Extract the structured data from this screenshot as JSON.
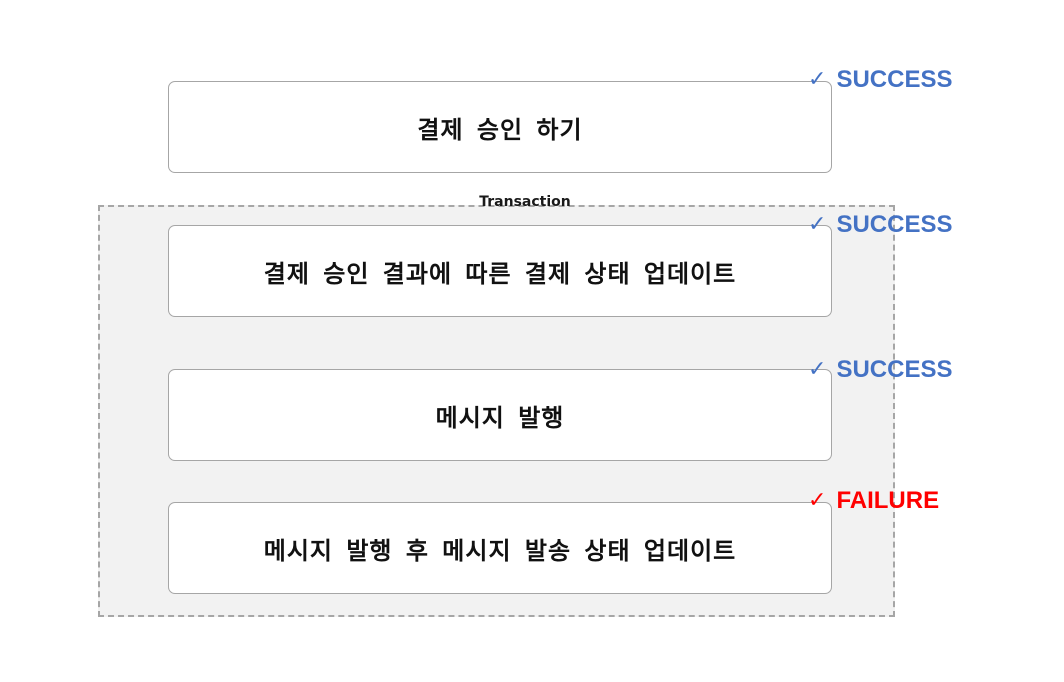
{
  "transaction": {
    "label": "Transaction"
  },
  "steps": [
    {
      "label": "결제 승인 하기",
      "status": "SUCCESS",
      "status_color": "#4472c4",
      "check_color": "#4472c4"
    },
    {
      "label": "결제 승인 결과에 따른 결제 상태 업데이트",
      "status": "SUCCESS",
      "status_color": "#4472c4",
      "check_color": "#4472c4"
    },
    {
      "label": "메시지 발행",
      "status": "SUCCESS",
      "status_color": "#4472c4",
      "check_color": "#4472c4"
    },
    {
      "label": "메시지 발행 후 메시지 발송 상태 업데이트",
      "status": "FAILURE",
      "status_color": "#ff0000",
      "check_color": "#ff0000"
    }
  ],
  "icons": {
    "check": "✓",
    "check_name": "check-icon"
  }
}
